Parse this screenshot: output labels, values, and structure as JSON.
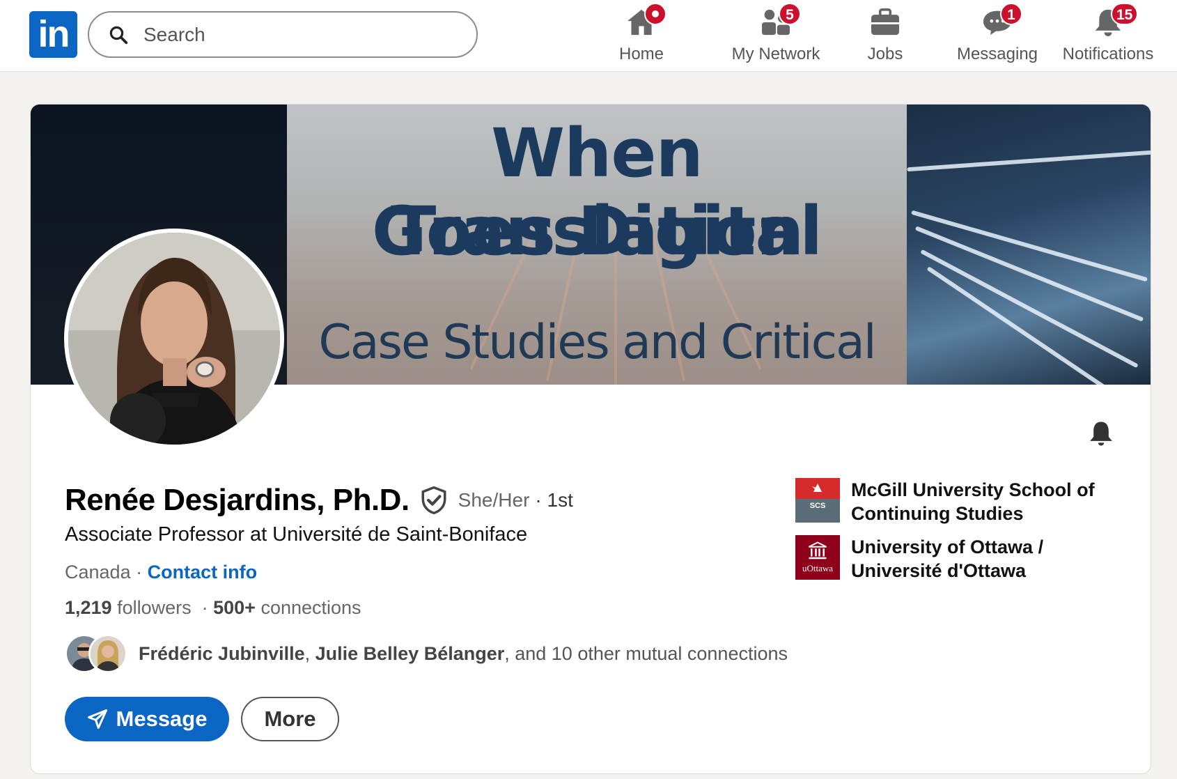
{
  "nav": {
    "logo_text": "in",
    "search_placeholder": "Search",
    "items": [
      {
        "label": "Home",
        "badge": "",
        "icon": "home-icon"
      },
      {
        "label": "My Network",
        "badge": "5",
        "icon": "people-icon"
      },
      {
        "label": "Jobs",
        "badge": "",
        "icon": "briefcase-icon"
      },
      {
        "label": "Messaging",
        "badge": "1",
        "icon": "chat-icon"
      },
      {
        "label": "Notifications",
        "badge": "15",
        "icon": "bell-icon"
      }
    ]
  },
  "banner": {
    "line1": "When Translation",
    "line2": "Goes Digital",
    "line3": "Case Studies and Critical"
  },
  "profile": {
    "name": "Renée Desjardins, Ph.D.",
    "pronouns": "She/Her",
    "degree": "· 1st",
    "headline": "Associate Professor at Université de Saint-Boniface",
    "location": "Canada",
    "location_sep": " · ",
    "contact_label": "Contact info",
    "followers_count": "1,219",
    "followers_label": " followers",
    "connections_sep": "  · ",
    "connections_count": "500+",
    "connections_label": " connections",
    "mutual_name1": "Frédéric Jubinville",
    "mutual_sep": ", ",
    "mutual_name2": "Julie Belley Bélanger",
    "mutual_rest": ", and 10 other mutual connections"
  },
  "actions": {
    "message_label": "Message",
    "more_label": "More"
  },
  "education": [
    {
      "name": "McGill University School of Continuing Studies",
      "logo_text": "SCS"
    },
    {
      "name": "University of Ottawa / Université d'Ottawa",
      "logo_text": "uOttawa"
    }
  ],
  "colors": {
    "brand_blue": "#0a66c2",
    "badge_red": "#cb112d",
    "background": "#f4f2ee"
  }
}
